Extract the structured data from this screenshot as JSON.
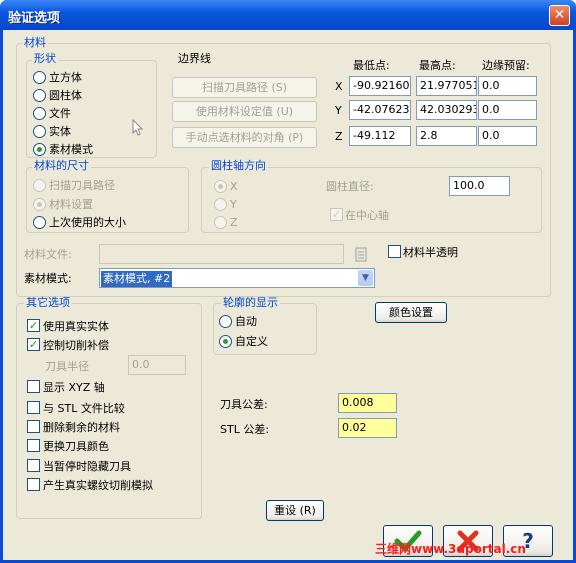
{
  "window": {
    "title": "验证选项"
  },
  "material": {
    "label": "材料",
    "shape": {
      "label": "形状",
      "options": [
        "立方体",
        "圆柱体",
        "文件",
        "实体",
        "素材模式"
      ],
      "selected": 4
    },
    "boundary": {
      "label": "边界线",
      "buttons": [
        "扫描刀具路径 (S)",
        "使用材料设定值 (U)",
        "手动点选材料的对角 (P)"
      ]
    },
    "coords": {
      "headers": [
        "最低点:",
        "最高点:",
        "边缘预留:"
      ],
      "rows": [
        {
          "axis": "X",
          "min": "-90.92160",
          "max": "21.977051",
          "margin": "0.0"
        },
        {
          "axis": "Y",
          "min": "-42.07623",
          "max": "42.030293",
          "margin": "0.0"
        },
        {
          "axis": "Z",
          "min": "-49.112",
          "max": "2.8",
          "margin": "0.0"
        }
      ]
    },
    "size": {
      "label": "材料的尺寸",
      "options": [
        "扫描刀具路径",
        "材料设置",
        "上次使用的大小"
      ],
      "selected": 2
    },
    "cylaxis": {
      "label": "圆柱轴方向",
      "options": [
        "X",
        "Y",
        "Z"
      ],
      "diameter_label": "圆柱直径:",
      "diameter_value": "100.0",
      "center_label": "在中心轴"
    },
    "file_label": "材料文件:",
    "translucent_label": "材料半透明",
    "mode_label": "素材模式:",
    "mode_value": "素材模式, #2"
  },
  "other": {
    "label": "其它选项",
    "items": [
      {
        "label": "使用真实实体",
        "checked": true
      },
      {
        "label": "控制切削补偿",
        "checked": true
      },
      {
        "label": "显示 XYZ 轴",
        "checked": false
      },
      {
        "label": "与 STL 文件比较",
        "checked": false
      },
      {
        "label": "删除剩余的材料",
        "checked": false
      },
      {
        "label": "更换刀具颜色",
        "checked": false
      },
      {
        "label": "当暂停时隐藏刀具",
        "checked": false
      },
      {
        "label": "产生真实螺纹切削模拟",
        "checked": false
      }
    ],
    "tool_radius_label": "刀具半径",
    "tool_radius_value": "0.0"
  },
  "contour": {
    "label": "轮廓的显示",
    "options": [
      "自动",
      "自定义"
    ],
    "selected": 1
  },
  "color_button": "颜色设置",
  "tool_tol_label": "刀具公差:",
  "tool_tol_value": "0.008",
  "stl_tol_label": "STL 公差:",
  "stl_tol_value": "0.02",
  "reset_button": "重设 (R)",
  "ok_icon": "check-icon",
  "cancel_icon": "x-icon",
  "help_icon": "question-icon",
  "watermark": "三维网www.3dportal.cn",
  "colors": {
    "titlebar": "#0a58e0",
    "group_label": "#0046d5",
    "tolerance_bg": "#ffff99",
    "ok": "#21a121",
    "cancel": "#e0301e",
    "help": "#1a3a8a",
    "watermark": "#ff1a1a"
  }
}
